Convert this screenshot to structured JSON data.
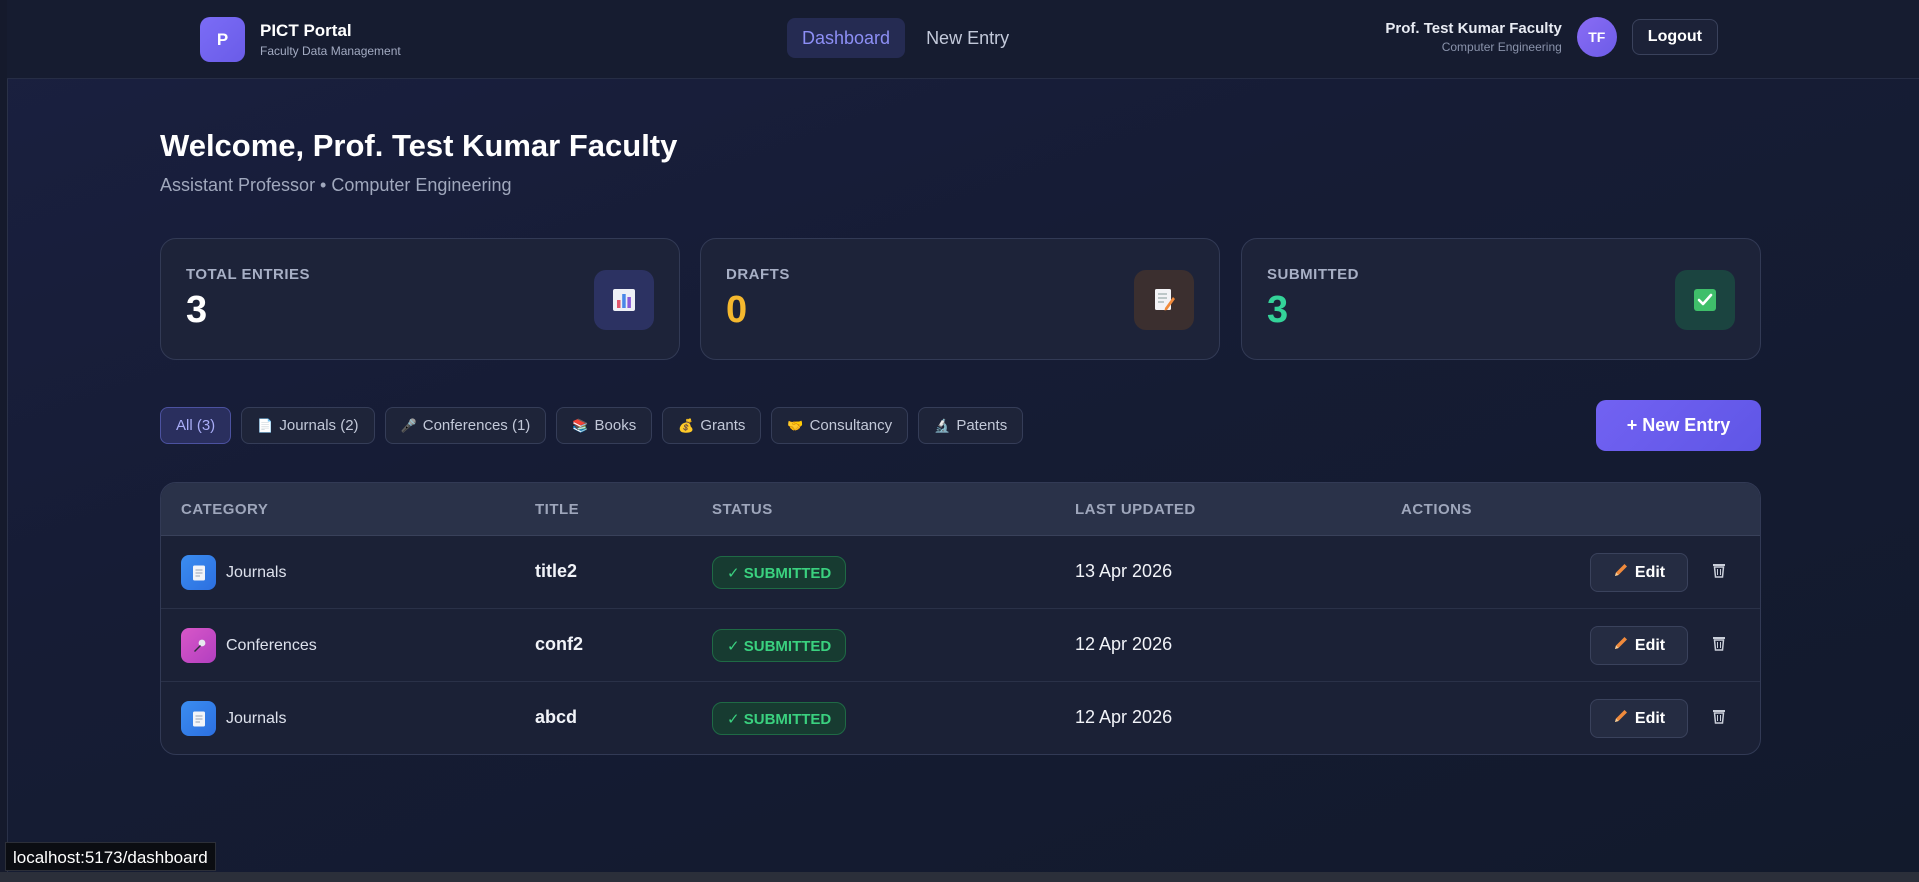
{
  "brand": {
    "logo_letter": "P",
    "title": "PICT Portal",
    "subtitle": "Faculty Data Management"
  },
  "nav": {
    "items": [
      {
        "label": "Dashboard",
        "active": true
      },
      {
        "label": "New Entry",
        "active": false
      }
    ]
  },
  "user": {
    "name": "Prof. Test Kumar Faculty",
    "department": "Computer Engineering",
    "initials": "TF",
    "logout_label": "Logout"
  },
  "welcome": {
    "title": "Welcome, Prof. Test Kumar Faculty",
    "subtitle": "Assistant Professor • Computer Engineering"
  },
  "stats": [
    {
      "label": "TOTAL ENTRIES",
      "value": "3",
      "color": "#ffffff",
      "icon": "bar-chart-icon"
    },
    {
      "label": "DRAFTS",
      "value": "0",
      "color": "#f5b82e",
      "icon": "memo-pencil-icon"
    },
    {
      "label": "SUBMITTED",
      "value": "3",
      "color": "#34d399",
      "icon": "check-box-icon"
    }
  ],
  "filters": [
    {
      "label": "All (3)",
      "icon": "",
      "active": true
    },
    {
      "label": "Journals (2)",
      "icon": "📄",
      "active": false
    },
    {
      "label": "Conferences (1)",
      "icon": "🎤",
      "active": false
    },
    {
      "label": "Books",
      "icon": "📚",
      "active": false
    },
    {
      "label": "Grants",
      "icon": "💰",
      "active": false
    },
    {
      "label": "Consultancy",
      "icon": "🤝",
      "active": false
    },
    {
      "label": "Patents",
      "icon": "🔬",
      "active": false
    }
  ],
  "new_entry_label": "+ New Entry",
  "table": {
    "headers": [
      "CATEGORY",
      "TITLE",
      "STATUS",
      "LAST UPDATED",
      "ACTIONS"
    ],
    "rows": [
      {
        "category": "Journals",
        "category_icon": "journal-icon",
        "title": "title2",
        "status": "✓ SUBMITTED",
        "updated": "13 Apr 2026",
        "edit": "Edit"
      },
      {
        "category": "Conferences",
        "category_icon": "microphone-icon",
        "title": "conf2",
        "status": "✓ SUBMITTED",
        "updated": "12 Apr 2026",
        "edit": "Edit"
      },
      {
        "category": "Journals",
        "category_icon": "journal-icon",
        "title": "abcd",
        "status": "✓ SUBMITTED",
        "updated": "12 Apr 2026",
        "edit": "Edit"
      }
    ]
  },
  "status_url": "localhost:5173/dashboard",
  "colors": {
    "accent": "#6c63ff",
    "success": "#3ad17f",
    "drafts": "#f5b82e",
    "submitted": "#34d399"
  }
}
